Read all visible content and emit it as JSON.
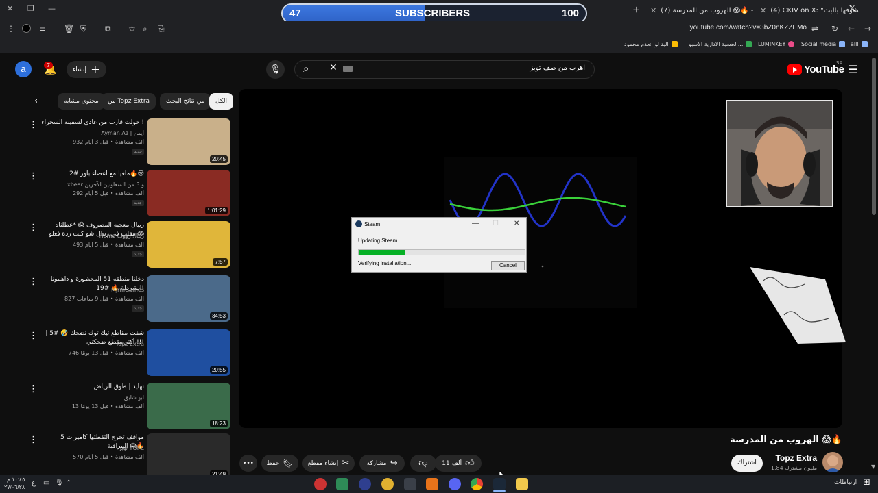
{
  "browser": {
    "tabs": [
      {
        "title": "(4) CKIV on X: \"ده بنشوفها بالبث"
      },
      {
        "title": "(7) الهروب من المدرسة 😱🔥 - ..."
      }
    ],
    "url": "youtube.com/watch?v=3bZ0nKZZEMo",
    "bookmarks": [
      {
        "label": "alll",
        "color": "#5f6368"
      },
      {
        "label": "Social media",
        "color": "#5f6368"
      },
      {
        "label": "LUMINKEY",
        "color": "#ea4c89"
      },
      {
        "label": "الحسبة الادارية الاسبو...",
        "color": "#34a853"
      },
      {
        "label": "اليد لو انعدم محمود",
        "color": "#fbbc04"
      }
    ]
  },
  "subscriber_widget": {
    "current": "47",
    "label": "SUBSCRIBERS",
    "goal": "100",
    "progress": 0.47
  },
  "header": {
    "avatar_letter": "a",
    "notification_count": "7",
    "create_label": "إنشاء",
    "search_query": "اهرب من صف توبز",
    "logo_text": "YouTube",
    "region": "SA"
  },
  "chips": [
    {
      "label": "الكل",
      "active": true
    },
    {
      "label": "من نتائج البحث"
    },
    {
      "label": "من Topz Extra"
    },
    {
      "label": "محتوى مشابه"
    }
  ],
  "recommended": [
    {
      "title": "حولت قارب من عادي لسفينة السحراء !",
      "channel": "Ayman Az | أيمن",
      "meta": "932 ألف مشاهدة • قبل 3 أيام",
      "badge": "جديد",
      "duration": "20:45",
      "thumb": "#c9b08a"
    },
    {
      "title": "مافيا مع اعضاء باور #2🔥😢",
      "channel": "xbear و 3 من المتعاونين الآخرين",
      "meta": "292 ألف مشاهدة • قبل 5 أيام",
      "badge": "جديد",
      "duration": "1:01:29",
      "thumb": "#8a2b23"
    },
    {
      "title": "ريبال معجبه المصروف 😱 *عطلناه مقلب في ريبال شو كنت ردة فعلو 😱 ...",
      "channel": "Home ريبال رؤوف",
      "meta": "493 ألف مشاهدة • قبل 5 أيام",
      "badge": "جديد",
      "duration": "7:57",
      "thumb": "#e0b63a"
    },
    {
      "title": "دخلنا منطقه 51 المحظورة و داهمونا الشرطة 🔥 #19!",
      "channel": "MjrmGames",
      "meta": "827 ألف مشاهدة • قبل 9 ساعات",
      "badge": "جديد",
      "duration": "34:53",
      "thumb": "#4b6a8a"
    },
    {
      "title": "شفت مقاطع تيك توك تضحك 🤣 #5 | أكثر مقطع ضحكني !!!",
      "channel": "Topz Extra",
      "meta": "746 ألف مشاهدة • قبل 13 يومًا",
      "badge": "",
      "duration": "20:55",
      "thumb": "#1f4fa0"
    },
    {
      "title": "تهايد | طوق الرياض",
      "channel": "ابو شايق",
      "meta": "13 ألف مشاهدة • قبل 13 يومًا",
      "badge": "",
      "duration": "18:23",
      "thumb": "#3a6b4a"
    },
    {
      "title": "5 مواقف تحرج التقطتها كاميرات المراقبة 😱🔥",
      "channel": "توبز TOPZ",
      "meta": "570 ألف مشاهدة • قبل 5 أيام",
      "badge": "",
      "duration": "21:49",
      "thumb": "#2a2a2a"
    }
  ],
  "steam_dialog": {
    "title": "Steam",
    "status": "Updating Steam...",
    "progress": 0.28,
    "detail": "Verifying installation...",
    "cancel_label": "Cancel"
  },
  "video": {
    "title": "الهروب من المدرسة 😱🔥",
    "channel_name": "Topz Extra",
    "channel_subs": "1.84 مليون مشترك",
    "subscribe_label": "اشتراك",
    "like_count": "11 ألف",
    "share_label": "مشاركة",
    "clip_label": "إنشاء مقطع",
    "save_label": "حفظ",
    "more_label": "•••"
  },
  "taskbar": {
    "time": "١٠:٤٥ م",
    "date": "٢٧/٠٦/٢٨",
    "lang": "ع",
    "notifications_label": "ارتباطات"
  }
}
